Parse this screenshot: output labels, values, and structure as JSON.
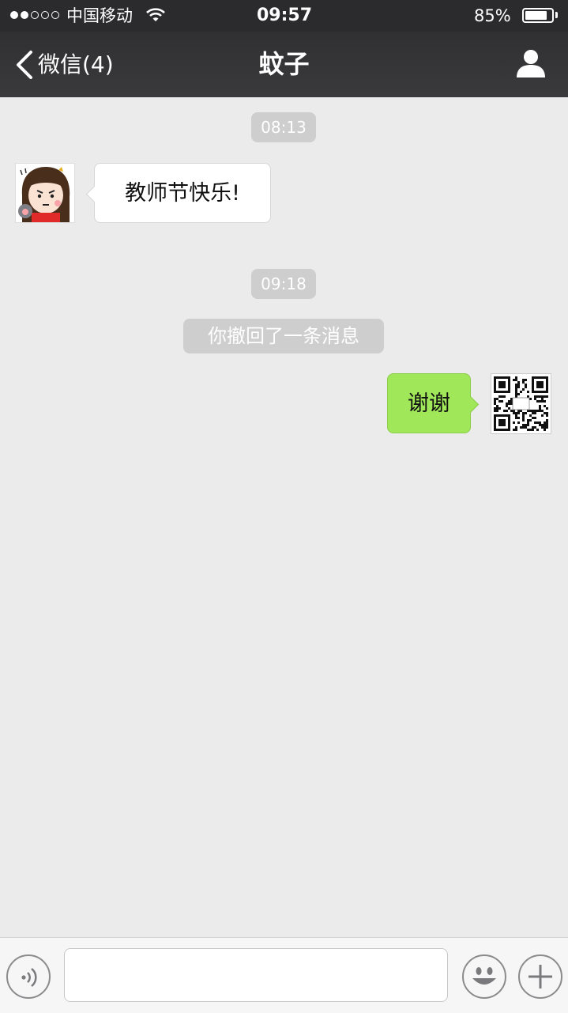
{
  "status_bar": {
    "carrier": "中国移动",
    "time": "09:57",
    "battery": "85%",
    "battery_level": 0.85,
    "signal_bars": 2,
    "signal_total": 5
  },
  "nav": {
    "back_label": "微信(4)",
    "title": "蚊子",
    "profile_icon": "person-icon"
  },
  "messages": [
    {
      "type": "time",
      "text": "08:13"
    },
    {
      "type": "received",
      "text": "教师节快乐!",
      "avatar": "cartoon-girl-avatar"
    },
    {
      "type": "time",
      "text": "09:18"
    },
    {
      "type": "system",
      "text": "你撤回了一条消息"
    },
    {
      "type": "sent",
      "text": "谢谢",
      "avatar": "qr-code-avatar"
    }
  ],
  "input_bar": {
    "voice_icon": "voice-icon",
    "emoji_icon": "emoji-icon",
    "plus_icon": "plus-icon",
    "text_value": ""
  },
  "colors": {
    "status_bg": "#2b2b2d",
    "nav_bg": "#373739",
    "chat_bg": "#ebebeb",
    "sent_bubble": "#a0e75a",
    "received_bubble": "#ffffff",
    "time_pill": "#cecece"
  }
}
